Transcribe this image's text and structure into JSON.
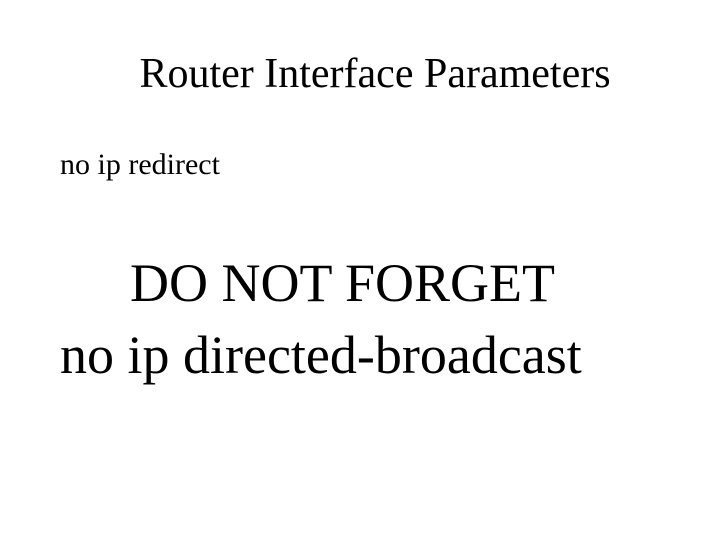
{
  "slide": {
    "title": "Router Interface Parameters",
    "subtitle": "no ip redirect",
    "emphasis_line1": "DO NOT FORGET",
    "emphasis_line2": "no ip directed-broadcast"
  }
}
